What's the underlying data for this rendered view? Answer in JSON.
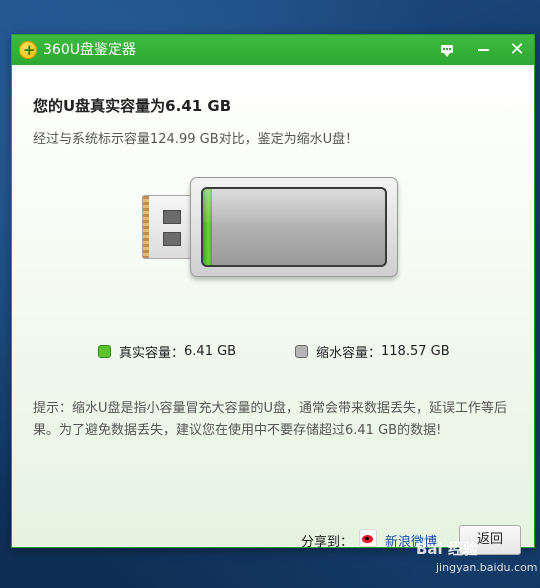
{
  "window": {
    "title": "360U盘鉴定器"
  },
  "result": {
    "headline": "您的U盘真实容量为6.41 GB",
    "subline": "经过与系统标示容量124.99 GB对比，鉴定为缩水U盘！"
  },
  "usb_visual": {
    "real_capacity_fraction": 0.051,
    "real_color": "#5ec42b",
    "shrink_color": "#b5b5b5"
  },
  "legend": {
    "real_label": "真实容量：",
    "real_value": "6.41 GB",
    "shrink_label": "缩水容量：",
    "shrink_value": "118.57 GB"
  },
  "tip": {
    "text": "提示：缩水U盘是指小容量冒充大容量的U盘，通常会带来数据丢失，延误工作等后果。为了避免数据丢失，建议您在使用中不要存储超过6.41 GB的数据!"
  },
  "footer": {
    "share_label": "分享到：",
    "weibo_label": "新浪微博",
    "back_label": "返回"
  },
  "watermark": {
    "brand": "Bai 经验",
    "url": "jingyan.baidu.com"
  },
  "colors": {
    "titlebar": "#2ea831",
    "accent_link": "#1f4ea3"
  }
}
